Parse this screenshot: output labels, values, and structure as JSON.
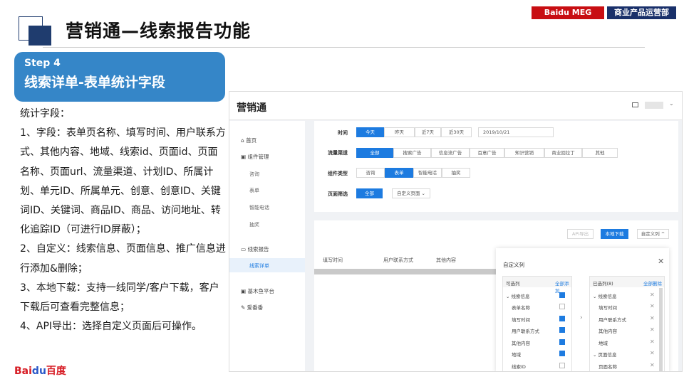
{
  "header": {
    "title": "营销通—线索报告功能",
    "brand1": "Baidu MEG",
    "brand2": "商业产品运营部"
  },
  "step": {
    "label": "Step 4",
    "title": "线索详单-表单统计字段"
  },
  "desc": {
    "p0": "统计字段：",
    "p1": "1、字段：表单页名称、填写时间、用户联系方式、其他内容、地域、线索id、页面id、页面名称、页面url、流量渠道、计划ID、所属计划、单元ID、所属单元、创意、创意ID、关键词ID、关键词、商品ID、商品、访问地址、转化追踪ID（可进行ID屏蔽）；",
    "p2": "2、自定义：线索信息、页面信息、推广信息进行添加&删除；",
    "p3": "3、本地下载：支持一线同学/客户下载，客户下载后可查看完整信息；",
    "p4": "4、API导出：选择自定义页面后可操作。"
  },
  "logo": {
    "a": "Bai",
    "b": "du",
    "c": "百度"
  },
  "shot": {
    "app_name": "营销通",
    "nav": {
      "home": "首页",
      "components": "组件管理",
      "consult": "咨询",
      "form": "表单",
      "phone": "智能电话",
      "lottery": "抽奖",
      "report": "线索报告",
      "detail": "线索详单",
      "fish": "基木鱼平台",
      "ai": "爱番番"
    },
    "filters": {
      "time_label": "时间",
      "time": [
        "今天",
        "昨天",
        "近7天",
        "近30天"
      ],
      "date": "2019/10/21",
      "channel_label": "流量渠道",
      "channel": [
        "全部",
        "搜索广告",
        "信息流广告",
        "百意广告",
        "知识营销",
        "商业回拉丁",
        "其他"
      ],
      "type_label": "组件类型",
      "type": [
        "咨询",
        "表单",
        "智能电话",
        "抽奖"
      ],
      "page_label": "页面筛选",
      "page_all": "全部",
      "page_custom": "自定义页面"
    },
    "actions": {
      "api": "API导出",
      "download": "本地下载",
      "custom": "自定义列"
    },
    "table_headers": [
      "填写时间",
      "用户联系方式",
      "其他内容"
    ],
    "modal": {
      "title": "自定义列",
      "selectable": "可选列",
      "select_all": "全部添加",
      "selected": "已选列(8)",
      "remove_all": "全部删除",
      "left_items": [
        "线索信息",
        "表单名称",
        "填写时间",
        "用户联系方式",
        "其他内容",
        "地域",
        "线索ID"
      ],
      "right_items": [
        "线索信息",
        "填写时间",
        "用户联系方式",
        "其他内容",
        "地域",
        "页面信息",
        "页面名称"
      ]
    }
  }
}
